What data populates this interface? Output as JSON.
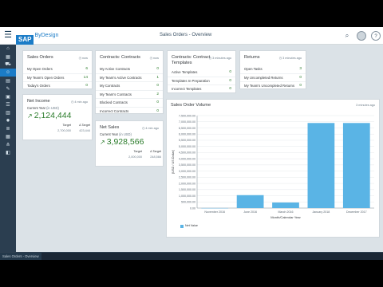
{
  "shell": {
    "title": "Sales Orders - Overview",
    "logo_sap": "SAP",
    "logo_product": "ByDesign"
  },
  "sidebar": {
    "items": [
      {
        "icon": "home-icon",
        "glyph": "⌂"
      },
      {
        "icon": "tile-icon",
        "glyph": "▦"
      },
      {
        "icon": "cart-icon",
        "glyph": "⛟"
      },
      {
        "icon": "person-icon",
        "glyph": "☺"
      },
      {
        "icon": "document-icon",
        "glyph": "▤"
      },
      {
        "icon": "notes-icon",
        "glyph": "✎"
      },
      {
        "icon": "box-icon",
        "glyph": "▣"
      },
      {
        "icon": "contacts-icon",
        "glyph": "☰"
      },
      {
        "icon": "chart-icon",
        "glyph": "▥"
      },
      {
        "icon": "gear-icon",
        "glyph": "✹"
      },
      {
        "icon": "list-icon",
        "glyph": "≣"
      },
      {
        "icon": "calendar-icon",
        "glyph": "▦"
      },
      {
        "icon": "hierarchy-icon",
        "glyph": "⋔"
      },
      {
        "icon": "share-icon",
        "glyph": "◧"
      }
    ],
    "active_index": 3
  },
  "cards": {
    "sales_orders": {
      "title": "Sales Orders",
      "time": "now",
      "rows": [
        {
          "label": "My Open Orders",
          "value": "6"
        },
        {
          "label": "My Team's Open Orders",
          "value": "14"
        },
        {
          "label": "Today's Orders",
          "value": "0"
        }
      ]
    },
    "contracts": {
      "title": "Contracts: Contracts",
      "time": "now",
      "rows": [
        {
          "label": "My Active Contracts",
          "value": "0"
        },
        {
          "label": "My Team's Active Contracts",
          "value": "1"
        },
        {
          "label": "My Contracts",
          "value": "0"
        },
        {
          "label": "My Team's Contracts",
          "value": "2"
        },
        {
          "label": "Blocked Contracts",
          "value": "0"
        },
        {
          "label": "Incorrect Contracts",
          "value": "0"
        }
      ]
    },
    "templates": {
      "title_line1": "Contracts: Contract",
      "title_line2": "Templates",
      "time": "3 minutes ago",
      "rows": [
        {
          "label": "Active Templates",
          "value": "0"
        },
        {
          "label": "Templates In Preparation",
          "value": "0"
        },
        {
          "label": "Incorrect Templates",
          "value": "0"
        }
      ]
    },
    "returns": {
      "title": "Returns",
      "time": "3 minutes ago",
      "rows": [
        {
          "label": "Open Tasks",
          "value": "3"
        },
        {
          "label": "My Uncompleted Returns",
          "value": "0"
        },
        {
          "label": "My Team's Uncompleted Returns",
          "value": "0"
        }
      ]
    },
    "net_income": {
      "title": "Net Income",
      "time": "4 min ago",
      "subtitle": "Current Year",
      "unit": "(in USD)",
      "value": "2,124,444",
      "target_label": "Target",
      "target_value": "2,700,000",
      "delta_label": "Δ Target",
      "delta_value": "423,444"
    },
    "net_sales": {
      "title": "Net Sales",
      "time": "4 min ago",
      "subtitle": "Current Year",
      "unit": "(in USD)",
      "value": "3,928,566",
      "target_label": "Target",
      "target_value": "2,000,000",
      "delta_label": "Δ Target",
      "delta_value": "248,566"
    }
  },
  "chart_card": {
    "title": "Sales Order Volume",
    "time": "3 minutes ago",
    "legend": "Net Value"
  },
  "chart_data": {
    "type": "bar",
    "categories": [
      "November 2016",
      "June 2016",
      "March 2016",
      "January 2018",
      "December 2017"
    ],
    "values": [
      5000,
      1050000,
      450000,
      6900000,
      6900000
    ],
    "ylabel": "[USD / US Dollar]",
    "xlabel": "Month/Calendar Year",
    "ylim": [
      0,
      7500000
    ],
    "yticks": [
      "0.00",
      "500,000.00",
      "1,000,000.00",
      "1,500,000.00",
      "2,000,000.00",
      "2,500,000.00",
      "3,000,000.00",
      "3,500,000.00",
      "4,000,000.00",
      "4,500,000.00",
      "5,000,000.00",
      "5,500,000.00",
      "6,000,000.00",
      "6,500,000.00",
      "7,000,000.00",
      "7,500,000.00"
    ],
    "series": [
      {
        "name": "Net Value",
        "color": "#5ab4e5"
      }
    ],
    "grid": true,
    "legend_position": "bottom-left"
  },
  "taskbar": {
    "tab": "Sales Orders - Overview"
  }
}
